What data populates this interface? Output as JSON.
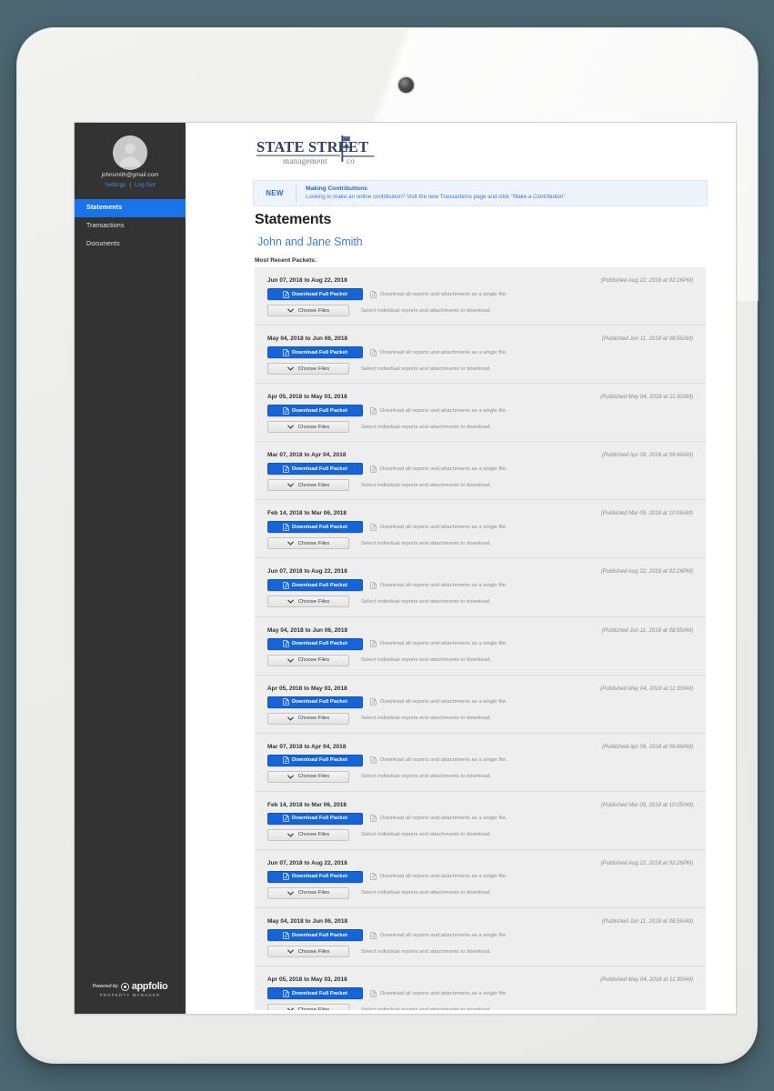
{
  "device": {
    "kind": "tablet-frame",
    "camera": "front-camera-lens"
  },
  "sidebar": {
    "avatar_icon": "user-avatar-icon",
    "user_email": "johnsmith@gmail.com",
    "settings_label": "Settings",
    "separator": "|",
    "logout_label": "Log Out",
    "nav": [
      {
        "label": "Statements",
        "active": true
      },
      {
        "label": "Transactions",
        "active": false
      },
      {
        "label": "Documents",
        "active": false
      }
    ],
    "footer": {
      "prefix": "Powered by",
      "brand": "appfolio",
      "subtitle": "PROPERTY MANAGER"
    }
  },
  "logo": {
    "line1": "STATE STREET",
    "line2_a": "management",
    "line2_b": "co",
    "icon": "street-lamp-sign-icon",
    "color": "#3d4f79"
  },
  "banner": {
    "badge": "NEW",
    "title": "Making Contributions",
    "body": "Looking to make an online contribution? Visit the new Transactions page and click \"Make a Contribution\".",
    "bg": "#eef3fc",
    "accent": "#2a64c4"
  },
  "header": {
    "page_title": "Statements",
    "account_name": "John and Jane Smith",
    "section_label": "Most Recent Packets:"
  },
  "labels": {
    "download_button": "Download Full Packet",
    "download_icon": "document-download-icon",
    "download_helper": "Download all reports and attachments as a single file.",
    "download_helper_icon": "document-icon",
    "choose_button": "Choose Files",
    "choose_icon": "chevron-down-icon",
    "choose_helper": "Select individual reports and attachments to download."
  },
  "colors": {
    "accent_blue": "#1565d8",
    "nav_active": "#1a73e8",
    "sidebar_bg": "#333333",
    "row_bg": "#eeeeee",
    "page_bg": "#4c6772"
  },
  "packets": [
    {
      "range": "Jun 07, 2018 to Aug 22, 2018",
      "published": "(Published Aug 22, 2018 at 02:26PM)"
    },
    {
      "range": "May 04, 2018 to Jun 06, 2018",
      "published": "(Published Jun 11, 2018 at 08:55AM)"
    },
    {
      "range": "Apr 05, 2018 to May 03, 2018",
      "published": "(Published May 04, 2018 at 11:30AM)"
    },
    {
      "range": "Mar 07, 2018 to Apr 04, 2018",
      "published": "(Published Apr 09, 2018 at 09:49AM)"
    },
    {
      "range": "Feb 14, 2018 to Mar 06, 2018",
      "published": "(Published Mar 09, 2018 at 10:05AM)"
    },
    {
      "range": "Jun 07, 2018 to Aug 22, 2018",
      "published": "(Published Aug 22, 2018 at 02:26PM)"
    },
    {
      "range": "May 04, 2018 to Jun 06, 2018",
      "published": "(Published Jun 11, 2018 at 08:55AM)"
    },
    {
      "range": "Apr 05, 2018 to May 03, 2018",
      "published": "(Published May 04, 2018 at 11:30AM)"
    },
    {
      "range": "Mar 07, 2018 to Apr 04, 2018",
      "published": "(Published Apr 09, 2018 at 09:49AM)"
    },
    {
      "range": "Feb 14, 2018 to Mar 06, 2018",
      "published": "(Published Mar 09, 2018 at 10:05AM)"
    },
    {
      "range": "Jun 07, 2018 to Aug 22, 2018",
      "published": "(Published Aug 22, 2018 at 02:26PM)"
    },
    {
      "range": "May 04, 2018 to Jun 06, 2018",
      "published": "(Published Jun 11, 2018 at 08:55AM)"
    },
    {
      "range": "Apr 05, 2018 to May 03, 2018",
      "published": "(Published May 04, 2018 at 11:30AM)"
    }
  ]
}
